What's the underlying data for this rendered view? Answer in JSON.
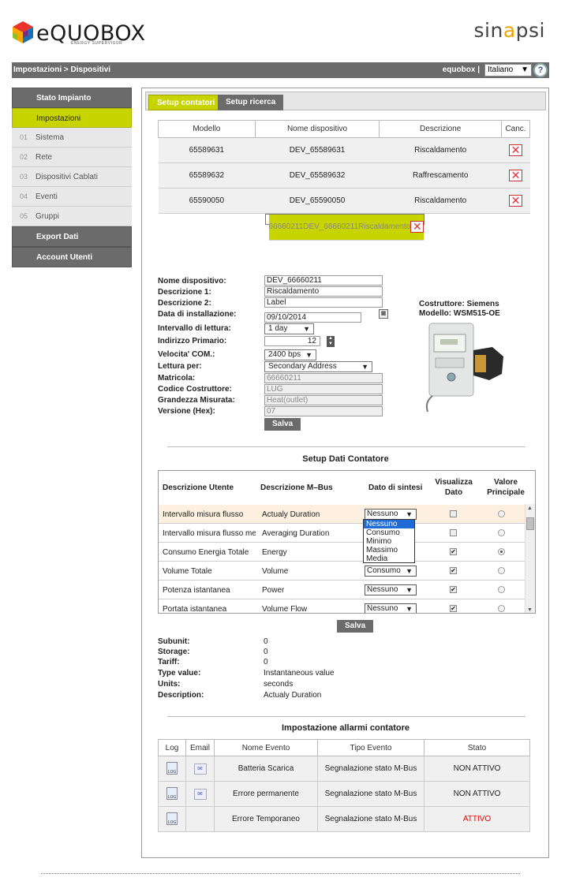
{
  "header": {
    "logo_text": "eQUOBOX",
    "logo_sub": "ENERGY SUPERVISOR",
    "brand": [
      "sin",
      "a",
      "psi"
    ]
  },
  "topbar": {
    "breadcrumb": "Impostazioni > Dispositivi",
    "user": "equobox |",
    "language": "Italiano",
    "help": "?"
  },
  "sidebar": {
    "items": [
      {
        "label": "Stato Impianto",
        "num": ""
      },
      {
        "label": "Impostazioni",
        "num": ""
      },
      {
        "label": "Sistema",
        "num": "01"
      },
      {
        "label": "Rete",
        "num": "02"
      },
      {
        "label": "Dispositivi Cablati",
        "num": "03"
      },
      {
        "label": "Eventi",
        "num": "04"
      },
      {
        "label": "Gruppi",
        "num": "05"
      },
      {
        "label": "Export Dati",
        "num": ""
      },
      {
        "label": "Account Utenti",
        "num": ""
      }
    ]
  },
  "tabs": [
    "Setup contatori",
    "Setup ricerca"
  ],
  "devices": {
    "headers": [
      "Modello",
      "Nome dispositivo",
      "Descrizione",
      "Canc."
    ],
    "rows": [
      {
        "modello": "65589631",
        "nome": "DEV_65589631",
        "descrizione": "Riscaldamento"
      },
      {
        "modello": "65589632",
        "nome": "DEV_65589632",
        "descrizione": "Raffrescamento"
      },
      {
        "modello": "65590050",
        "nome": "DEV_65590050",
        "descrizione": "Riscaldamento"
      },
      {
        "modello": "66660211",
        "nome": "DEV_66660211",
        "descrizione": "Riscaldamento"
      }
    ]
  },
  "form": {
    "labels": [
      "Nome dispositivo:",
      "Descrizione 1:",
      "Descrizione 2:",
      "Data di installazione:",
      "Intervallo di lettura:",
      "Indirizzo Primario:",
      "Velocita' COM.:",
      "Lettura per:",
      "Matricola:",
      "Codice Costruttore:",
      "Grandezza Misurata:",
      "Versione (Hex):"
    ],
    "nome": "DEV_66660211",
    "descr1": "Riscaldamento",
    "descr2": "Label",
    "data": "09/10/2014",
    "intervallo": "1 day",
    "indirizzo": "12",
    "velocita": "2400 bps",
    "lettura": "Secondary Address",
    "matricola": "66660211",
    "codice": "LUG",
    "grandezza": "Heat(outlet)",
    "versione": "07",
    "save": "Salva"
  },
  "maker": {
    "costruttore": "Costruttore: Siemens",
    "modello": "Modello: WSM515-OE"
  },
  "setup_dati": {
    "title": "Setup Dati Contatore",
    "headers": [
      "Descrizione Utente",
      "Descrizione M–Bus",
      "Dato di sintesi",
      "Visualizza Dato",
      "Valore Principale"
    ],
    "rows": [
      {
        "utente": "Intervallo misura flusso",
        "mbus": "Actualy Duration",
        "sintesi": "Nessuno",
        "visualizza": false,
        "principale": false
      },
      {
        "utente": "Intervallo misura flusso me",
        "mbus": "Averaging Duration",
        "sintesi": "",
        "visualizza": false,
        "principale": false
      },
      {
        "utente": "Consumo Energia Totale",
        "mbus": "Energy",
        "sintesi": "",
        "visualizza": true,
        "principale": true
      },
      {
        "utente": "Volume Totale",
        "mbus": "Volume",
        "sintesi": "Consumo",
        "visualizza": true,
        "principale": false
      },
      {
        "utente": "Potenza istantanea",
        "mbus": "Power",
        "sintesi": "Nessuno",
        "visualizza": true,
        "principale": false
      },
      {
        "utente": "Portata istantanea",
        "mbus": "Volume Flow",
        "sintesi": "Nessuno",
        "visualizza": true,
        "principale": false
      }
    ],
    "dropdown_options": [
      "Nessuno",
      "Consumo",
      "Minimo",
      "Massimo",
      "Media"
    ],
    "save": "Salva"
  },
  "info": [
    {
      "label": "Subunit:",
      "value": "0"
    },
    {
      "label": "Storage:",
      "value": "0"
    },
    {
      "label": "Tariff:",
      "value": "0"
    },
    {
      "label": "Type value:",
      "value": "Instantaneous value"
    },
    {
      "label": "Units:",
      "value": "seconds"
    },
    {
      "label": "Description:",
      "value": "Actualy Duration"
    }
  ],
  "alarms": {
    "title": "Impostazione allarmi contatore",
    "headers": [
      "Log",
      "Email",
      "Nome Evento",
      "Tipo Evento",
      "Stato"
    ],
    "rows": [
      {
        "nome": "Batteria Scarica",
        "tipo": "Segnalazione stato M-Bus",
        "stato": "NON ATTIVO",
        "email": true
      },
      {
        "nome": "Errore permanente",
        "tipo": "Segnalazione stato M-Bus",
        "stato": "NON ATTIVO",
        "email": true
      },
      {
        "nome": "Errore Temporaneo",
        "tipo": "Segnalazione stato M-Bus",
        "stato": "ATTIVO",
        "email": false
      }
    ],
    "log_icon_text": "LOG",
    "active_color": "#e00000"
  },
  "colors": {
    "accent": "#c8d400",
    "dark": "#6b6b6b"
  }
}
